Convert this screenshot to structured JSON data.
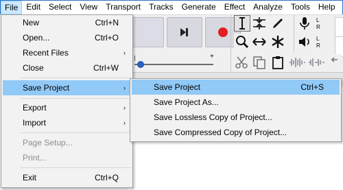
{
  "menubar": {
    "items": [
      "File",
      "Edit",
      "Select",
      "View",
      "Transport",
      "Tracks",
      "Generate",
      "Effect",
      "Analyze",
      "Tools",
      "Help"
    ]
  },
  "toolbar": {
    "meter_top": "L\nR",
    "meter_l": "L",
    "meter_r": "R",
    "plus": "+"
  },
  "file_menu": {
    "items": [
      {
        "label": "New",
        "shortcut": "Ctrl+N"
      },
      {
        "label": "Open...",
        "shortcut": "Ctrl+O"
      },
      {
        "label": "Recent Files",
        "submenu": true
      },
      {
        "label": "Close",
        "shortcut": "Ctrl+W"
      },
      {
        "label": "Save Project",
        "submenu": true,
        "highlighted": true
      },
      {
        "label": "Export",
        "submenu": true
      },
      {
        "label": "Import",
        "submenu": true
      },
      {
        "label": "Page Setup...",
        "disabled": true
      },
      {
        "label": "Print...",
        "disabled": true
      },
      {
        "label": "Exit",
        "shortcut": "Ctrl+Q"
      }
    ],
    "arrow": "›"
  },
  "save_submenu": {
    "items": [
      {
        "label": "Save Project",
        "shortcut": "Ctrl+S",
        "highlighted": true
      },
      {
        "label": "Save Project As..."
      },
      {
        "label": "Save Lossless Copy of Project..."
      },
      {
        "label": "Save Compressed Copy of Project..."
      }
    ]
  },
  "colors": {
    "menu_highlight": "#91c9f7",
    "menubar_active": "#cce8ff",
    "record": "#e02020"
  }
}
